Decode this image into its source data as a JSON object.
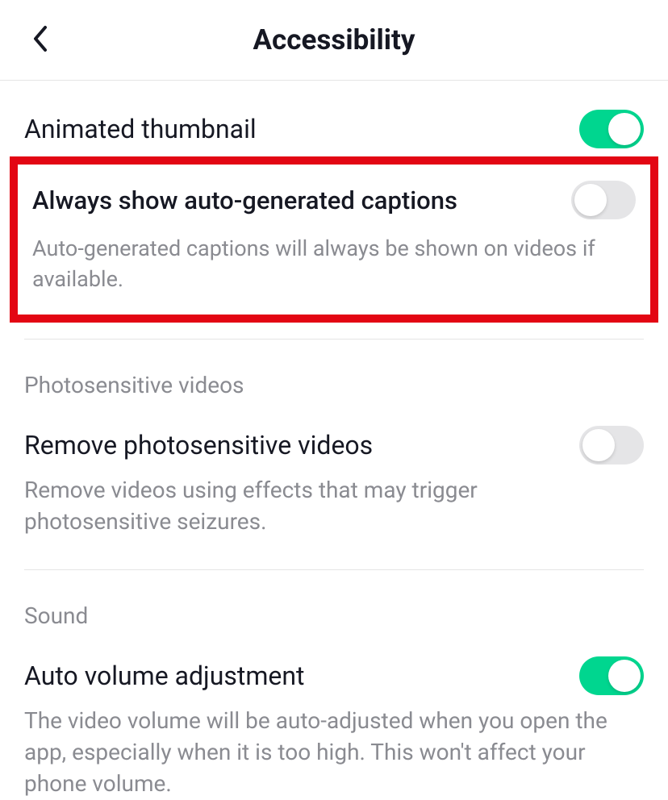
{
  "header": {
    "title": "Accessibility"
  },
  "settings": {
    "animated_thumbnail": {
      "label": "Animated thumbnail",
      "enabled": true
    },
    "auto_captions": {
      "label": "Always show auto-generated captions",
      "description": "Auto-generated captions will always be shown on videos if available.",
      "enabled": false
    },
    "photosensitive_section": {
      "header": "Photosensitive videos"
    },
    "remove_photosensitive": {
      "label": "Remove photosensitive videos",
      "description": "Remove videos using effects that may trigger photosensitive seizures.",
      "enabled": false
    },
    "sound_section": {
      "header": "Sound"
    },
    "auto_volume": {
      "label": "Auto volume adjustment",
      "description": "The video volume will be auto-adjusted when you open the app, especially when it is too high. This won't affect your phone volume.",
      "enabled": true
    }
  }
}
